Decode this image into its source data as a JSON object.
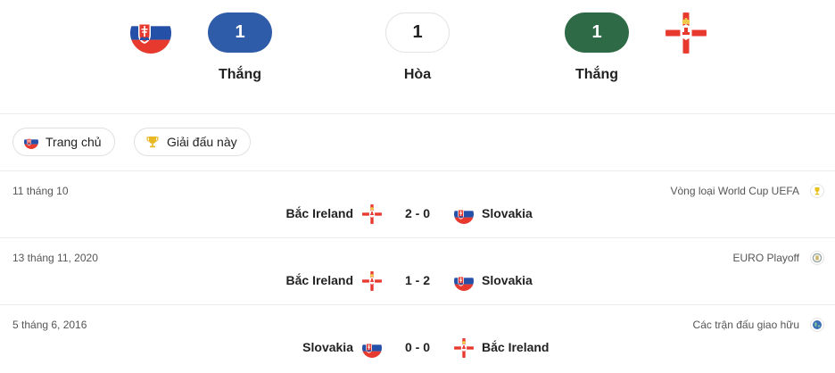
{
  "summary": {
    "home_team_flag": "slovakia-flag",
    "away_team_flag": "northern-ireland-flag",
    "home_wins": "1",
    "draws": "1",
    "away_wins": "1",
    "home_wins_label": "Thắng",
    "draws_label": "Hòa",
    "away_wins_label": "Thắng",
    "colors": {
      "home": "#2f5ca8",
      "away": "#2e6a45"
    }
  },
  "filters": [
    {
      "label": "Trang chủ",
      "icon": "slovakia-flag"
    },
    {
      "label": "Giải đấu này",
      "icon": "trophy-icon"
    }
  ],
  "matches": [
    {
      "date": "11 tháng 10",
      "competition": "Vòng loại World Cup UEFA",
      "competition_icon": "world-cup-icon",
      "home": "Bắc Ireland",
      "home_flag": "northern-ireland-flag",
      "score": "2 - 0",
      "away": "Slovakia",
      "away_flag": "slovakia-flag"
    },
    {
      "date": "13 tháng 11, 2020",
      "competition": "EURO Playoff",
      "competition_icon": "euro-icon",
      "home": "Bắc Ireland",
      "home_flag": "northern-ireland-flag",
      "score": "1 - 2",
      "away": "Slovakia",
      "away_flag": "slovakia-flag"
    },
    {
      "date": "5 tháng 6, 2016",
      "competition": "Các trận đấu giao hữu",
      "competition_icon": "globe-icon",
      "home": "Slovakia",
      "home_flag": "slovakia-flag",
      "score": "0 - 0",
      "away": "Bắc Ireland",
      "away_flag": "northern-ireland-flag"
    }
  ]
}
